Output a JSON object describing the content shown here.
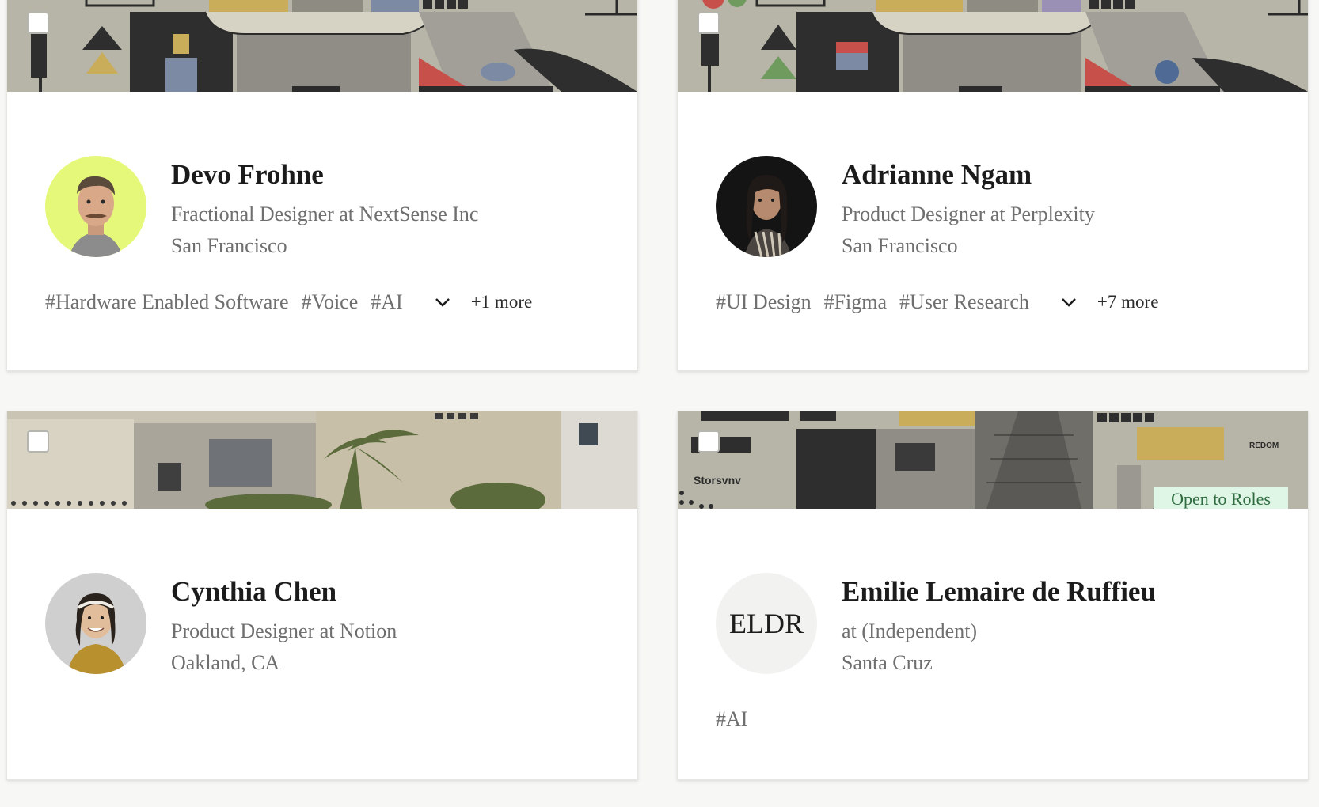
{
  "cards": [
    {
      "name": "Devo Frohne",
      "role": "Fractional Designer at NextSense Inc",
      "location": "San Francisco",
      "tags": [
        "#Hardware Enabled Software",
        "#Voice",
        "#AI"
      ],
      "more": "+1 more",
      "avatar_bg": "#e6f87a"
    },
    {
      "name": "Adrianne Ngam",
      "role": "Product Designer at Perplexity",
      "location": "San Francisco",
      "tags": [
        "#UI Design",
        "#Figma",
        "#User Research"
      ],
      "more": "+7 more",
      "avatar_bg": "#141414"
    },
    {
      "name": "Cynthia Chen",
      "role": "Product Designer at Notion",
      "location": "Oakland, CA",
      "tags": [],
      "more": "",
      "avatar_bg": "#cfcfcf"
    },
    {
      "name": "Emilie Lemaire de Ruffieu",
      "role": "at (Independent)",
      "location": "Santa Cruz",
      "tags": [
        "#AI"
      ],
      "more": "",
      "initials": "ELDR",
      "badge": "Open to Roles",
      "avatar_bg": "#f2f2f0",
      "banner_text": {
        "left": "Storsvnv",
        "right": "REDOM"
      }
    }
  ],
  "colors": {
    "banner_bg": "#b5b3a5",
    "badge_bg": "#dff5e5",
    "badge_text": "#2e6b3f",
    "muted_text": "#6f6f6f"
  }
}
